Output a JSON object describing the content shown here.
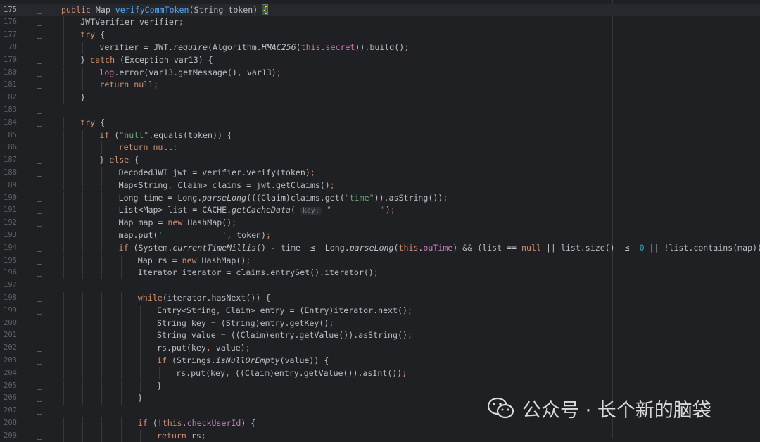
{
  "editor": {
    "current_line": "175",
    "watermark": "公众号 · 长个新的脑袋",
    "lines": [
      {
        "n": "175",
        "indent": 0,
        "tokens": [
          [
            "kw",
            "public "
          ],
          [
            "",
            "Map "
          ],
          [
            "fn",
            "verifyCommToken"
          ],
          [
            "",
            "(String token) "
          ],
          [
            "brace",
            "{"
          ]
        ]
      },
      {
        "n": "176",
        "indent": 1,
        "tokens": [
          [
            "",
            "JWTVerifier verifier"
          ],
          [
            "kw",
            ";"
          ]
        ]
      },
      {
        "n": "177",
        "indent": 1,
        "tokens": [
          [
            "kw",
            "try "
          ],
          [
            "",
            "{"
          ]
        ]
      },
      {
        "n": "178",
        "indent": 2,
        "tokens": [
          [
            "",
            "verifier = JWT."
          ],
          [
            "it",
            "require"
          ],
          [
            "",
            "(Algorithm."
          ],
          [
            "it",
            "HMAC256"
          ],
          [
            "",
            "("
          ],
          [
            "kw",
            "this"
          ],
          [
            "",
            "."
          ],
          [
            "fld",
            "secret"
          ],
          [
            "",
            "))."
          ],
          [
            "",
            "build()"
          ],
          [
            "kw",
            ";"
          ]
        ]
      },
      {
        "n": "179",
        "indent": 1,
        "tokens": [
          [
            "",
            "} "
          ],
          [
            "kw",
            "catch "
          ],
          [
            "",
            "(Exception var13) {"
          ]
        ]
      },
      {
        "n": "180",
        "indent": 2,
        "tokens": [
          [
            "fld",
            "log"
          ],
          [
            "",
            ".error(var13.getMessage()"
          ],
          [
            "kw",
            ", "
          ],
          [
            "",
            "var13)"
          ],
          [
            "kw",
            ";"
          ]
        ]
      },
      {
        "n": "181",
        "indent": 2,
        "tokens": [
          [
            "kw",
            "return null;"
          ]
        ]
      },
      {
        "n": "182",
        "indent": 1,
        "tokens": [
          [
            "",
            "}"
          ]
        ]
      },
      {
        "n": "183",
        "indent": 0,
        "tokens": []
      },
      {
        "n": "184",
        "indent": 1,
        "tokens": [
          [
            "kw",
            "try "
          ],
          [
            "",
            "{"
          ]
        ]
      },
      {
        "n": "185",
        "indent": 2,
        "tokens": [
          [
            "kw",
            "if "
          ],
          [
            "",
            "("
          ],
          [
            "str",
            "\"null\""
          ],
          [
            "",
            ".equals(token)) {"
          ]
        ]
      },
      {
        "n": "186",
        "indent": 3,
        "tokens": [
          [
            "kw",
            "return null;"
          ]
        ]
      },
      {
        "n": "187",
        "indent": 2,
        "tokens": [
          [
            "",
            "} "
          ],
          [
            "kw",
            "else "
          ],
          [
            "",
            "{"
          ]
        ]
      },
      {
        "n": "188",
        "indent": 3,
        "tokens": [
          [
            "",
            "DecodedJWT jwt = verifier.verify(token)"
          ],
          [
            "kw",
            ";"
          ]
        ]
      },
      {
        "n": "189",
        "indent": 3,
        "tokens": [
          [
            "",
            "Map<String"
          ],
          [
            "kw",
            ", "
          ],
          [
            "",
            "Claim> claims = jwt.getClaims()"
          ],
          [
            "kw",
            ";"
          ]
        ]
      },
      {
        "n": "190",
        "indent": 3,
        "tokens": [
          [
            "",
            "Long time = Long."
          ],
          [
            "it",
            "parseLong"
          ],
          [
            "",
            "(((Claim)claims.get("
          ],
          [
            "str",
            "\"time\""
          ],
          [
            "",
            "))."
          ],
          [
            "",
            "asString())"
          ],
          [
            "kw",
            ";"
          ]
        ]
      },
      {
        "n": "191",
        "indent": 3,
        "tokens": [
          [
            "",
            "List<Map> list = CACHE."
          ],
          [
            "it",
            "getCacheData"
          ],
          [
            "",
            "( "
          ],
          [
            "hint",
            "key:"
          ],
          [
            "",
            " "
          ],
          [
            "str",
            "\""
          ],
          [
            "blur",
            "          "
          ],
          [
            "str",
            "\""
          ],
          [
            "",
            ")"
          ],
          [
            "kw",
            ";"
          ]
        ]
      },
      {
        "n": "192",
        "indent": 3,
        "tokens": [
          [
            "",
            "Map map = "
          ],
          [
            "kw",
            "new "
          ],
          [
            "",
            "HashMap()"
          ],
          [
            "kw",
            ";"
          ]
        ]
      },
      {
        "n": "193",
        "indent": 3,
        "tokens": [
          [
            "",
            "map.put("
          ],
          [
            "str",
            "'"
          ],
          [
            "blur",
            "            "
          ],
          [
            "str",
            "'"
          ],
          [
            "kw",
            ", "
          ],
          [
            "",
            "token)"
          ],
          [
            "kw",
            ";"
          ]
        ]
      },
      {
        "n": "194",
        "indent": 3,
        "tokens": [
          [
            "kw",
            "if "
          ],
          [
            "",
            "(System."
          ],
          [
            "it",
            "currentTimeMillis"
          ],
          [
            "",
            "() - time  ≤  Long."
          ],
          [
            "it",
            "parseLong"
          ],
          [
            "",
            "("
          ],
          [
            "kw",
            "this"
          ],
          [
            "",
            "."
          ],
          [
            "fld",
            "ouTime"
          ],
          [
            "",
            ") && (list == "
          ],
          [
            "kw",
            "null "
          ],
          [
            "",
            "|| list.size()  ≤  "
          ],
          [
            "num",
            "0 "
          ],
          [
            "",
            "|| !list.contains(map))) {"
          ]
        ]
      },
      {
        "n": "195",
        "indent": 4,
        "tokens": [
          [
            "",
            "Map rs = "
          ],
          [
            "kw",
            "new "
          ],
          [
            "",
            "HashMap()"
          ],
          [
            "kw",
            ";"
          ]
        ]
      },
      {
        "n": "196",
        "indent": 4,
        "tokens": [
          [
            "",
            "Iterator iterator = claims.entrySet().iterator()"
          ],
          [
            "kw",
            ";"
          ]
        ]
      },
      {
        "n": "197",
        "indent": 0,
        "tokens": []
      },
      {
        "n": "198",
        "indent": 4,
        "tokens": [
          [
            "kw",
            "while"
          ],
          [
            "",
            "(iterator.hasNext()) {"
          ]
        ]
      },
      {
        "n": "199",
        "indent": 5,
        "tokens": [
          [
            "",
            "Entry<String"
          ],
          [
            "kw",
            ", "
          ],
          [
            "",
            "Claim> entry = (Entry)iterator.next()"
          ],
          [
            "kw",
            ";"
          ]
        ]
      },
      {
        "n": "200",
        "indent": 5,
        "tokens": [
          [
            "",
            "String key = (String)entry.getKey()"
          ],
          [
            "kw",
            ";"
          ]
        ]
      },
      {
        "n": "201",
        "indent": 5,
        "tokens": [
          [
            "",
            "String value = ((Claim)entry.getValue()).asString()"
          ],
          [
            "kw",
            ";"
          ]
        ]
      },
      {
        "n": "202",
        "indent": 5,
        "tokens": [
          [
            "",
            "rs.put(key"
          ],
          [
            "kw",
            ", "
          ],
          [
            "",
            "value)"
          ],
          [
            "kw",
            ";"
          ]
        ]
      },
      {
        "n": "203",
        "indent": 5,
        "tokens": [
          [
            "kw",
            "if "
          ],
          [
            "",
            "(Strings."
          ],
          [
            "it",
            "isNullOrEmpty"
          ],
          [
            "",
            "(value)) {"
          ]
        ]
      },
      {
        "n": "204",
        "indent": 6,
        "tokens": [
          [
            "",
            "rs.put(key"
          ],
          [
            "kw",
            ", "
          ],
          [
            "",
            "((Claim)entry.getValue()).asInt())"
          ],
          [
            "kw",
            ";"
          ]
        ]
      },
      {
        "n": "205",
        "indent": 5,
        "tokens": [
          [
            "",
            "}"
          ]
        ]
      },
      {
        "n": "206",
        "indent": 4,
        "tokens": [
          [
            "",
            "}"
          ]
        ]
      },
      {
        "n": "207",
        "indent": 0,
        "tokens": []
      },
      {
        "n": "208",
        "indent": 4,
        "tokens": [
          [
            "kw",
            "if "
          ],
          [
            "",
            "(!"
          ],
          [
            "kw",
            "this"
          ],
          [
            "",
            "."
          ],
          [
            "fld",
            "checkUserId"
          ],
          [
            "",
            ") {"
          ]
        ]
      },
      {
        "n": "209",
        "indent": 5,
        "tokens": [
          [
            "kw",
            "return "
          ],
          [
            "",
            "rs"
          ],
          [
            "kw",
            ";"
          ]
        ]
      }
    ]
  }
}
